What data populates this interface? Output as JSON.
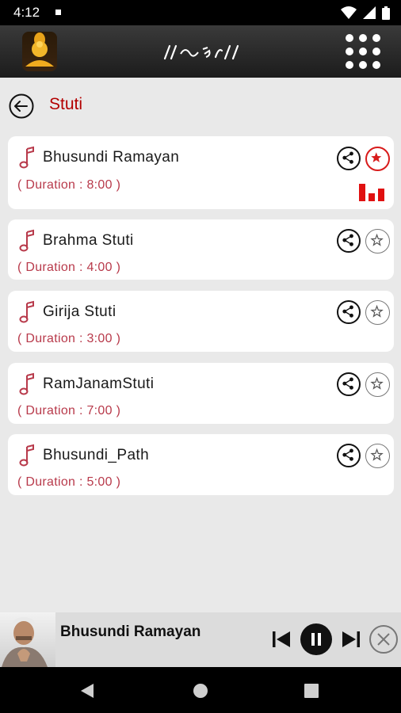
{
  "status_bar": {
    "time": "4:12"
  },
  "header": {
    "logo": "idol-logo-icon",
    "menu_icon": "grid-menu-icon"
  },
  "sub_header": {
    "title": "Stuti",
    "back_icon": "back-arrow-icon"
  },
  "songs": [
    {
      "name": "Bhusundi Ramayan",
      "duration": "( Duration : 8:00 )",
      "favorite": true,
      "playing": true
    },
    {
      "name": "Brahma Stuti",
      "duration": "( Duration : 4:00 )",
      "favorite": false,
      "playing": false
    },
    {
      "name": "Girija Stuti",
      "duration": "( Duration : 3:00 )",
      "favorite": false,
      "playing": false
    },
    {
      "name": "RamJanamStuti",
      "duration": "( Duration : 7:00 )",
      "favorite": false,
      "playing": false
    },
    {
      "name": "Bhusundi_Path",
      "duration": "( Duration : 5:00 )",
      "favorite": false,
      "playing": false
    }
  ],
  "player": {
    "title": "Bhusundi Ramayan",
    "state": "playing"
  },
  "colors": {
    "accent": "#b30000",
    "duration": "#b83a4b",
    "fav_active": "#d81b1b"
  }
}
